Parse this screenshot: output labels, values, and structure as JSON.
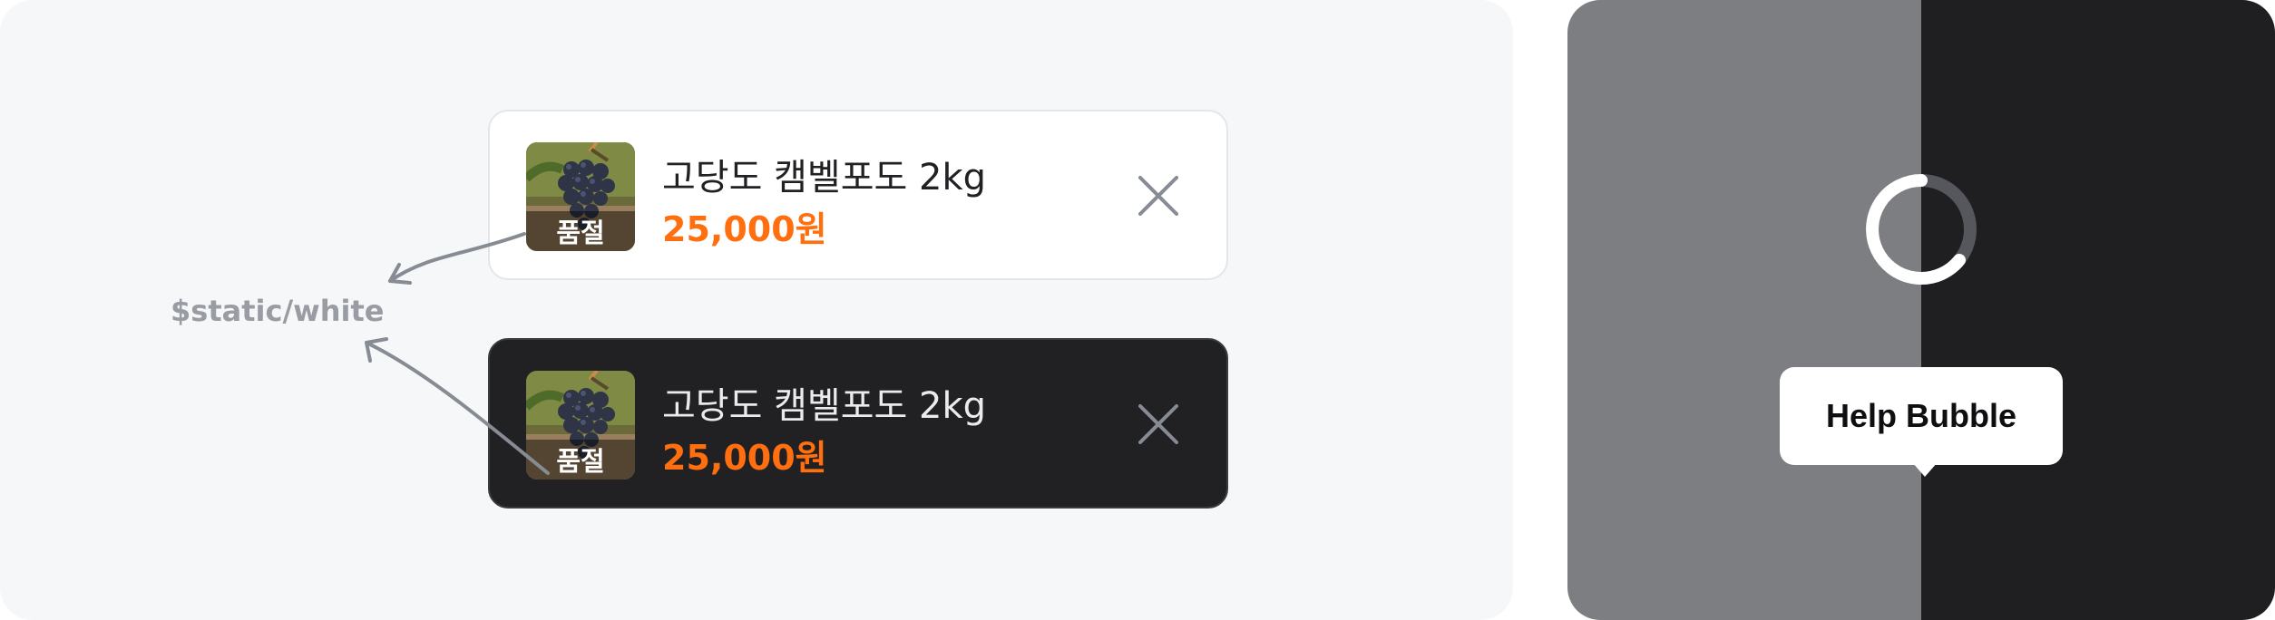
{
  "token_annotation": "$static/white",
  "cards": [
    {
      "theme": "light",
      "product_name": "고당도 캠벨포도 2kg",
      "price": "25,000원",
      "badge": "품절",
      "image_icon": "grape-icon",
      "close_icon": "close-icon"
    },
    {
      "theme": "dark",
      "product_name": "고당도 캠벨포도 2kg",
      "price": "25,000원",
      "badge": "품절",
      "image_icon": "grape-icon",
      "close_icon": "close-icon"
    }
  ],
  "help_bubble": {
    "label": "Help Bubble"
  },
  "colors": {
    "price_accent": "#ff6f0f",
    "light_surface": "#ffffff",
    "dark_surface": "#212124",
    "canvas": "#f6f7f9",
    "annotation": "#9a9ca3",
    "preview_gray": "#7c7e82",
    "preview_dark": "#1f1f22"
  }
}
